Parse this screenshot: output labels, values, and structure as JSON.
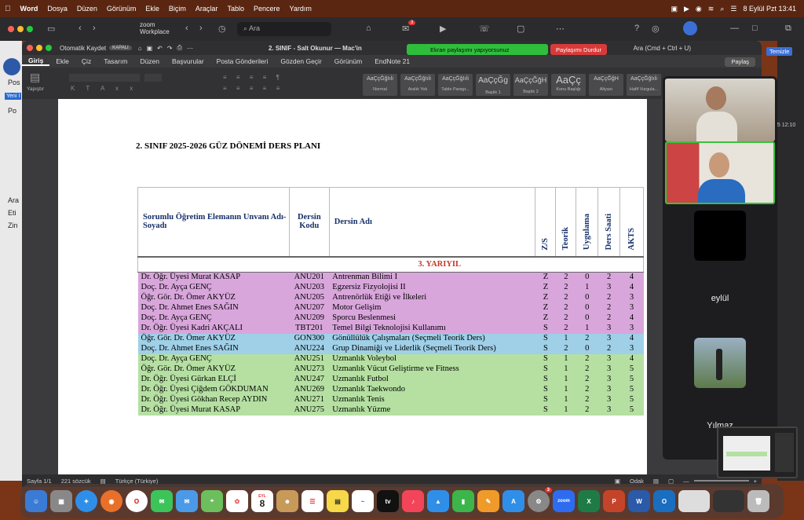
{
  "menubar": {
    "app": "Word",
    "items": [
      "Dosya",
      "Düzen",
      "Görünüm",
      "Ekle",
      "Biçim",
      "Araçlar",
      "Tablo",
      "Pencere",
      "Yardım"
    ],
    "datetime": "8 Eylül Pzt 13:41"
  },
  "zoom": {
    "title_line1": "zoom",
    "title_line2": "Workplace",
    "search_placeholder": "Ara",
    "chat_badge": "3"
  },
  "left_panel": {
    "labels": [
      "Pos",
      "Yeni I",
      "Po",
      "Ara",
      "Eti",
      "Zin"
    ]
  },
  "word": {
    "autosave_label": "Otomatik Kaydet",
    "autosave_state": "KAPALI",
    "doc_title": "2. SINIF - Salt Okunur — Mac'in",
    "share_banner": "Ekran paylaşımı yapıyorsunuz",
    "stop_share": "Paylaşımı Durdur",
    "search": "Ara (Cmd + Ctrl + U)",
    "ribbon_tabs": [
      "Giriş",
      "Ekle",
      "Çiz",
      "Tasarım",
      "Düzen",
      "Başvurular",
      "Posta Gönderileri",
      "Gözden Geçir",
      "Görünüm",
      "EndNote 21"
    ],
    "share_button": "Paylaş",
    "paste_label": "Yapıştır",
    "styles": [
      {
        "sample": "AaÇçĞğIıİi",
        "name": "Normal"
      },
      {
        "sample": "AaÇçĞğIıİi",
        "name": "Aralık Yok"
      },
      {
        "sample": "AaÇçĞğIıİi",
        "name": "Table Paragr..."
      },
      {
        "sample": "AaÇçĞg",
        "name": "Başlık 1"
      },
      {
        "sample": "AaÇçĞğH",
        "name": "Başlık 2"
      },
      {
        "sample": "AaÇç",
        "name": "Konu Başlığı"
      },
      {
        "sample": "AaÇçĞğH",
        "name": "Altyazı"
      },
      {
        "sample": "AaÇçĞğIıİi",
        "name": "Hafif Vurgula..."
      }
    ],
    "status": {
      "page": "Sayfa 1/1",
      "words": "221 sözcük",
      "language": "Türkçe (Türkiye)",
      "focus": "Odak"
    }
  },
  "document": {
    "title": "2. SINIF 2025-2026 GÜZ DÖNEMİ DERS PLANI",
    "headers": {
      "instructor": "Sorumlu Öğretim Elemanın Unvanı Adı-Soyadı",
      "code": "Dersin Kodu",
      "name": "Dersin Adı",
      "zs": "Z/S",
      "theory": "Teorik",
      "practice": "Uygulama",
      "hours": "Ders Saati",
      "ects": "AKTS"
    },
    "semester": "3. YARIYIL",
    "rows": [
      {
        "instructor": "Dr. Öğr. Üyesi Murat KASAP",
        "code": "ANU201",
        "name": "Antrenman Bilimi I",
        "zs": "Z",
        "t": "2",
        "u": "0",
        "s": "2",
        "akts": "4",
        "color": "#d9a6dc"
      },
      {
        "instructor": "Doç. Dr. Ayça GENÇ",
        "code": "ANU203",
        "name": "Egzersiz Fizyolojisi II",
        "zs": "Z",
        "t": "2",
        "u": "1",
        "s": "3",
        "akts": "4",
        "color": "#d9a6dc"
      },
      {
        "instructor": "Öğr. Gör. Dr. Ömer AKYÜZ",
        "code": "ANU205",
        "name": "Antrenörlük Etiği ve İlkeleri",
        "zs": "Z",
        "t": "2",
        "u": "0",
        "s": "2",
        "akts": "3",
        "color": "#d9a6dc"
      },
      {
        "instructor": "Doç. Dr. Ahmet Enes SAĞIN",
        "code": "ANU207",
        "name": "Motor Gelişim",
        "zs": "Z",
        "t": "2",
        "u": "0",
        "s": "2",
        "akts": "3",
        "color": "#d9a6dc"
      },
      {
        "instructor": "Doç. Dr. Ayça GENÇ",
        "code": "ANU209",
        "name": "Sporcu Beslenmesi",
        "zs": "Z",
        "t": "2",
        "u": "0",
        "s": "2",
        "akts": "4",
        "color": "#d9a6dc"
      },
      {
        "instructor": "Dr. Öğr. Üyesi Kadri AKÇALI",
        "code": "TBT201",
        "name": "Temel Bilgi Teknolojisi Kullanımı",
        "zs": "S",
        "t": "2",
        "u": "1",
        "s": "3",
        "akts": "3",
        "color": "#d9a6dc"
      },
      {
        "instructor": "Öğr. Gör. Dr. Ömer AKYÜZ",
        "code": "GON300",
        "name": "Gönüllülük Çalışmaları (Seçmeli Teorik Ders)",
        "zs": "S",
        "t": "1",
        "u": "2",
        "s": "3",
        "akts": "4",
        "color": "#9fd0e8"
      },
      {
        "instructor": "Doç. Dr. Ahmet Enes SAĞIN",
        "code": "ANU224",
        "name": "Grup Dinamiği ve Liderlik (Seçmeli Teorik Ders)",
        "zs": "S",
        "t": "2",
        "u": "0",
        "s": "2",
        "akts": "3",
        "color": "#9fd0e8"
      },
      {
        "instructor": "Doç. Dr. Ayça GENÇ",
        "code": "ANU251",
        "name": "Uzmanlık Voleybol",
        "zs": "S",
        "t": "1",
        "u": "2",
        "s": "3",
        "akts": "4",
        "color": "#b5e0a2"
      },
      {
        "instructor": "Öğr. Gör. Dr. Ömer AKYÜZ",
        "code": "ANU273",
        "name": "Uzmanlık Vücut Geliştirme ve Fitness",
        "zs": "S",
        "t": "1",
        "u": "2",
        "s": "3",
        "akts": "5",
        "color": "#b5e0a2"
      },
      {
        "instructor": "Dr. Öğr. Üyesi Gürkan ELÇİ",
        "code": "ANU247",
        "name": "Uzmanlık Futbol",
        "zs": "S",
        "t": "1",
        "u": "2",
        "s": "3",
        "akts": "5",
        "color": "#b5e0a2"
      },
      {
        "instructor": "Dr. Öğr. Üyesi Çiğdem GÖKDUMAN",
        "code": "ANU269",
        "name": "Uzmanlık Taekwondo",
        "zs": "S",
        "t": "1",
        "u": "2",
        "s": "3",
        "akts": "5",
        "color": "#b5e0a2"
      },
      {
        "instructor": "Dr. Öğr. Üyesi Gökhan Recep AYDIN",
        "code": "ANU271",
        "name": "Uzmanlık Tenis",
        "zs": "S",
        "t": "1",
        "u": "2",
        "s": "3",
        "akts": "5",
        "color": "#b5e0a2"
      },
      {
        "instructor": "Dr. Öğr. Üyesi Murat KASAP",
        "code": "ANU275",
        "name": "Uzmanlık Yüzme",
        "zs": "S",
        "t": "1",
        "u": "2",
        "s": "3",
        "akts": "5",
        "color": "#b5e0a2"
      }
    ]
  },
  "zoom_panel": {
    "participants": [
      "eylül",
      "Yılmaz"
    ]
  },
  "right_edge": {
    "button": "Temizle",
    "timestamp": "25 12:10"
  },
  "dock": {
    "calendar_month": "EYL",
    "calendar_day": "8",
    "settings_badge": "3"
  }
}
